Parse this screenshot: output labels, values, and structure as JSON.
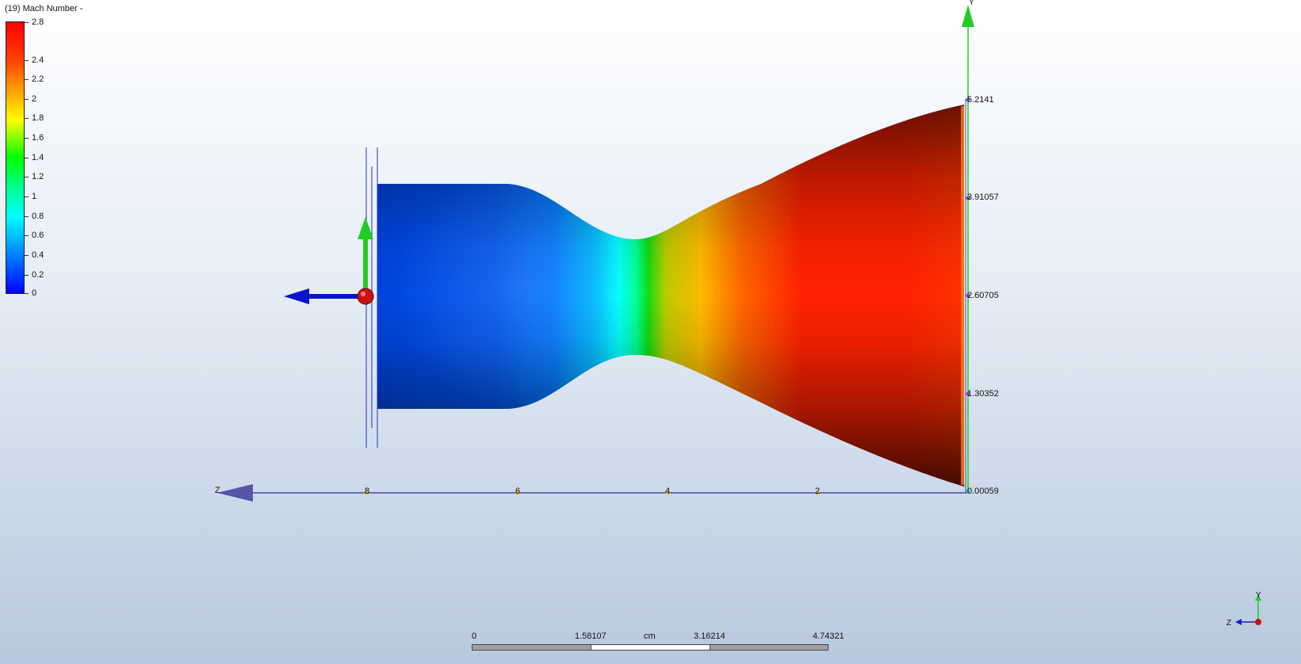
{
  "legend": {
    "title": "(19) Mach Number -",
    "ticks": [
      "2.8",
      "2.4",
      "2.2",
      "2",
      "1.8",
      "1.6",
      "1.4",
      "1.2",
      "1",
      "0.8",
      "0.6",
      "0.4",
      "0.2",
      "0"
    ]
  },
  "y_axis": {
    "name": "Y",
    "ticks": [
      "5.2141",
      "3.91057",
      "2.60705",
      "1.30352",
      "0.00059"
    ]
  },
  "z_axis": {
    "name": "Z",
    "ticks": [
      "8",
      "6",
      "4",
      "2"
    ]
  },
  "scale_bar": {
    "unit": "cm",
    "labels": [
      "0",
      "1.58107",
      "3.16214",
      "4.74321"
    ]
  },
  "triad": {
    "y_label": "Y",
    "z_label": "Z"
  },
  "colors": {
    "mach_max": "#ff0000",
    "mach_min": "#0000ff",
    "axis_z": "#4a4aa0",
    "axis_y": "#22cc22",
    "gizmo_origin": "#cc1111"
  },
  "icons": {
    "gizmo": "move-gizmo-icon",
    "triad": "axis-triad-icon"
  }
}
